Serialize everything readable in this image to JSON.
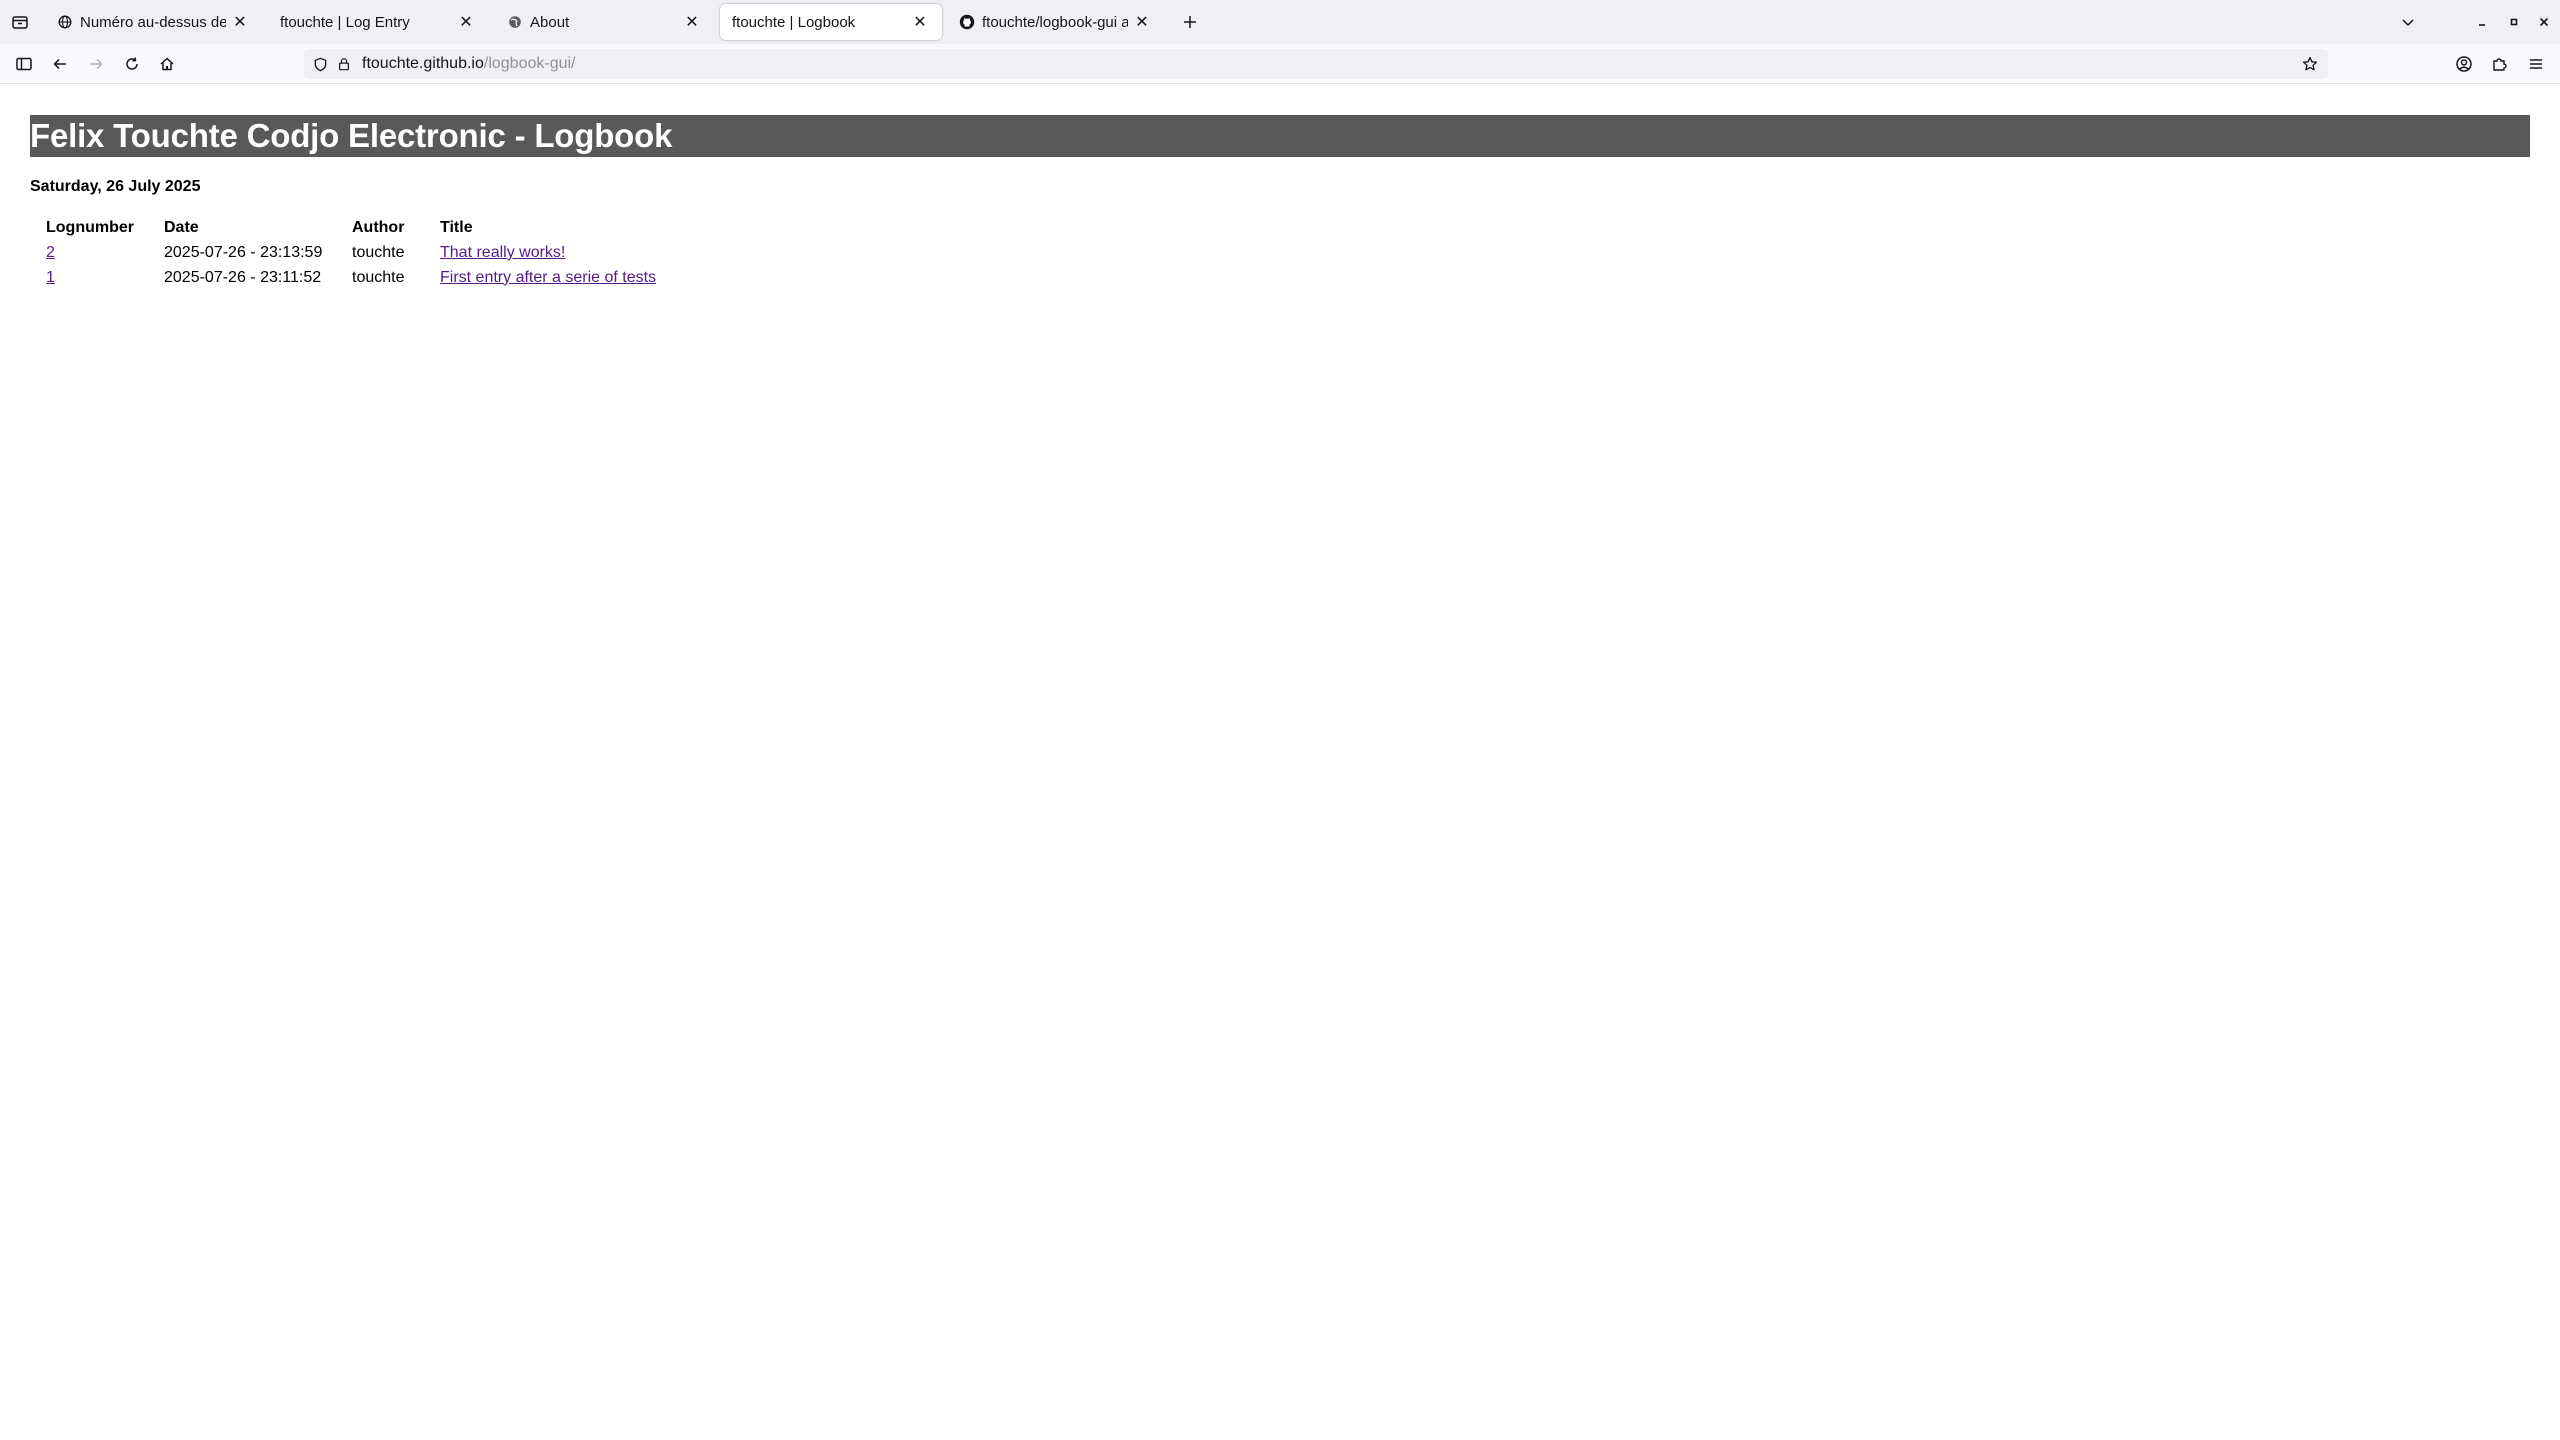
{
  "browser": {
    "tabs": [
      {
        "title": "Numéro au-dessus de l'im",
        "favicon": "globe-icon",
        "active": false
      },
      {
        "title": "ftouchte | Log Entry",
        "favicon": "none",
        "active": false
      },
      {
        "title": "About",
        "favicon": "globe-icon",
        "active": false
      },
      {
        "title": "ftouchte | Logbook",
        "favicon": "none",
        "active": true
      },
      {
        "title": "ftouchte/logbook-gui at g",
        "favicon": "github-icon",
        "active": false
      }
    ],
    "url": {
      "host": "ftouchte.github.io",
      "path": "/logbook-gui/"
    }
  },
  "page": {
    "header_title": "Felix Touchte Codjo Electronic - Logbook",
    "header_bg": "#595959",
    "date_heading": "Saturday, 26 July 2025",
    "table": {
      "columns": [
        "Lognumber",
        "Date",
        "Author",
        "Title"
      ],
      "rows": [
        {
          "lognumber": "2",
          "date": "2025-07-26 - 23:13:59",
          "author": "touchte",
          "title": "That really works!"
        },
        {
          "lognumber": "1",
          "date": "2025-07-26 - 23:11:52",
          "author": "touchte",
          "title": "First entry after a serie of tests"
        }
      ]
    },
    "link_color": "#551a8b"
  }
}
